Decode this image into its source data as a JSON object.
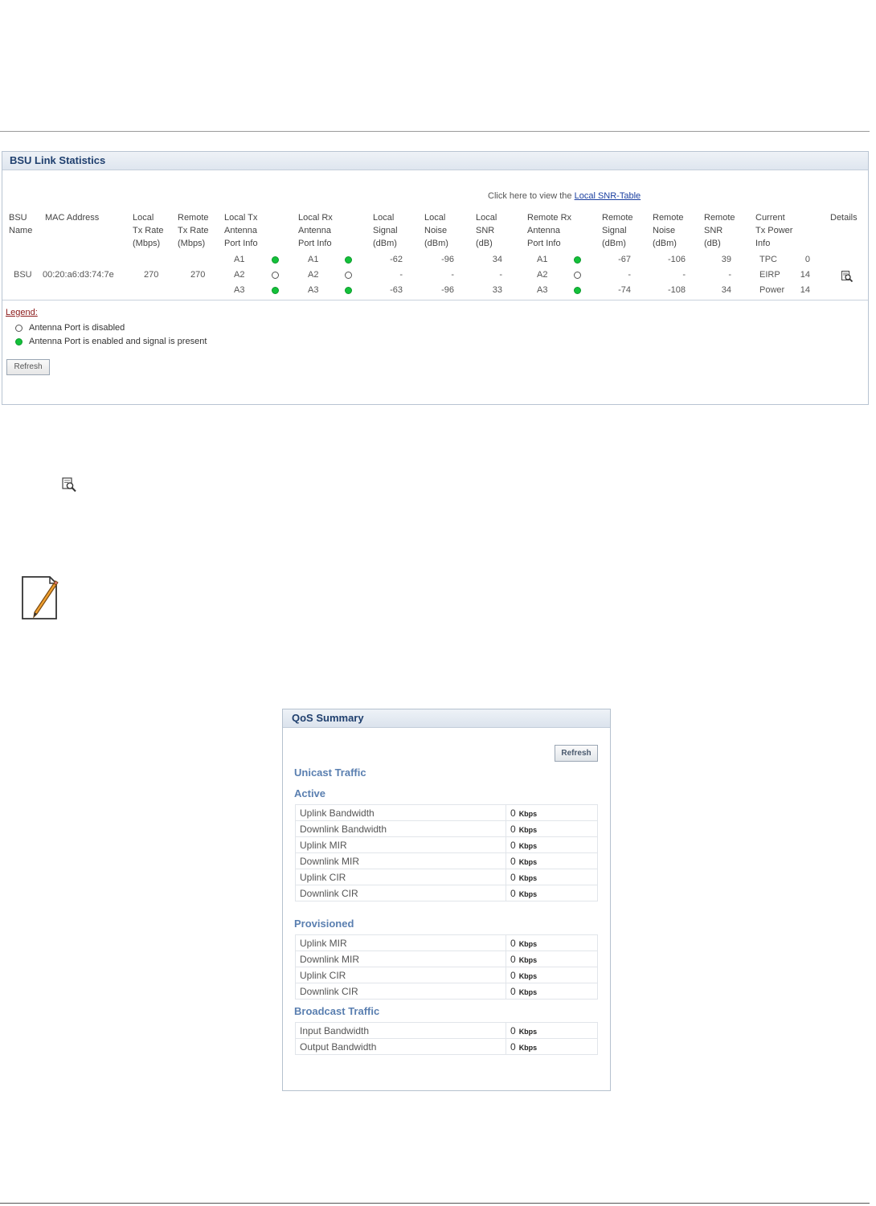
{
  "bsu_link_statistics": {
    "title": "BSU Link Statistics",
    "snr_prefix": "Click here to view the",
    "snr_link": "Local SNR-Table",
    "headers": [
      [
        "BSU",
        "Name"
      ],
      [
        "MAC Address"
      ],
      [
        "Local",
        "Tx Rate",
        "(Mbps)"
      ],
      [
        "Remote",
        "Tx Rate",
        "(Mbps)"
      ],
      [
        "Local Tx",
        "Antenna",
        "Port Info"
      ],
      [
        "Local Rx",
        "Antenna",
        "Port Info"
      ],
      [
        "Local",
        "Signal",
        "(dBm)"
      ],
      [
        "Local",
        "Noise",
        "(dBm)"
      ],
      [
        "Local",
        "SNR",
        "(dB)"
      ],
      [
        "Remote Rx",
        "Antenna",
        "Port Info"
      ],
      [
        "Remote",
        "Signal",
        "(dBm)"
      ],
      [
        "Remote",
        "Noise",
        "(dBm)"
      ],
      [
        "Remote",
        "SNR",
        "(dB)"
      ],
      [
        "Current",
        "Tx Power",
        "Info"
      ],
      [
        "Details"
      ]
    ],
    "row": {
      "name": "BSU",
      "mac": "00:20:a6:d3:74:7e",
      "local_tx_rate": "270",
      "remote_tx_rate": "270",
      "local_tx_ports": [
        {
          "port": "A1",
          "enabled": true
        },
        {
          "port": "A2",
          "enabled": false
        },
        {
          "port": "A3",
          "enabled": true
        }
      ],
      "local_rx_ports": [
        {
          "port": "A1",
          "enabled": true
        },
        {
          "port": "A2",
          "enabled": false
        },
        {
          "port": "A3",
          "enabled": true
        }
      ],
      "local_signal": [
        "-62",
        "-",
        "-63"
      ],
      "local_noise": [
        "-96",
        "-",
        "-96"
      ],
      "local_snr": [
        "34",
        "-",
        "33"
      ],
      "remote_rx_ports": [
        {
          "port": "A1",
          "enabled": true
        },
        {
          "port": "A2",
          "enabled": false
        },
        {
          "port": "A3",
          "enabled": true
        }
      ],
      "remote_signal": [
        "-67",
        "-",
        "-74"
      ],
      "remote_noise": [
        "-106",
        "-",
        "-108"
      ],
      "remote_snr": [
        "39",
        "-",
        "34"
      ],
      "tx_power": [
        {
          "label": "TPC",
          "value": "0"
        },
        {
          "label": "EIRP",
          "value": "14"
        },
        {
          "label": "Power",
          "value": "14"
        }
      ]
    },
    "legend_title": "Legend:",
    "legend_disabled": "Antenna Port is disabled",
    "legend_enabled": "Antenna Port is enabled and signal is present",
    "refresh_label": "Refresh",
    "colors": {
      "enabled": "#13c13a",
      "header_text": "#1f3f6e",
      "legend_title": "#8b1a1a"
    }
  },
  "qos_summary": {
    "title": "QoS Summary",
    "refresh_label": "Refresh",
    "unicast_label": "Unicast Traffic",
    "active_label": "Active",
    "active_rows": [
      {
        "label": "Uplink Bandwidth",
        "value": "0",
        "unit": "Kbps"
      },
      {
        "label": "Downlink Bandwidth",
        "value": "0",
        "unit": "Kbps"
      },
      {
        "label": "Uplink MIR",
        "value": "0",
        "unit": "Kbps"
      },
      {
        "label": "Downlink MIR",
        "value": "0",
        "unit": "Kbps"
      },
      {
        "label": "Uplink CIR",
        "value": "0",
        "unit": "Kbps"
      },
      {
        "label": "Downlink CIR",
        "value": "0",
        "unit": "Kbps"
      }
    ],
    "provisioned_label": "Provisioned",
    "provisioned_rows": [
      {
        "label": "Uplink MIR",
        "value": "0",
        "unit": "Kbps"
      },
      {
        "label": "Downlink MIR",
        "value": "0",
        "unit": "Kbps"
      },
      {
        "label": "Uplink CIR",
        "value": "0",
        "unit": "Kbps"
      },
      {
        "label": "Downlink CIR",
        "value": "0",
        "unit": "Kbps"
      }
    ],
    "broadcast_label": "Broadcast Traffic",
    "broadcast_rows": [
      {
        "label": "Input Bandwidth",
        "value": "0",
        "unit": "Kbps"
      },
      {
        "label": "Output Bandwidth",
        "value": "0",
        "unit": "Kbps"
      }
    ],
    "colors": {
      "section": "#5a7fb0",
      "header_text": "#1f3f6e"
    }
  },
  "icons": {
    "details": "magnifier-document-icon",
    "standalone": "magnifier-document-icon",
    "note": "note-pencil-icon"
  }
}
